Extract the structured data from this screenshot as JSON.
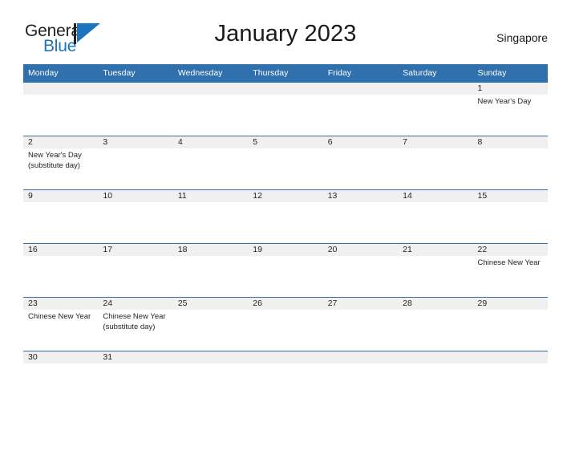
{
  "brand": {
    "name_part1": "General",
    "name_part2": "Blue",
    "mark_icon": "triangle-flag-icon"
  },
  "header": {
    "title": "January 2023",
    "locale": "Singapore"
  },
  "calendar": {
    "weekday_headers": [
      "Monday",
      "Tuesday",
      "Wednesday",
      "Thursday",
      "Friday",
      "Saturday",
      "Sunday"
    ],
    "weeks": [
      {
        "days": [
          {
            "date": "",
            "events": []
          },
          {
            "date": "",
            "events": []
          },
          {
            "date": "",
            "events": []
          },
          {
            "date": "",
            "events": []
          },
          {
            "date": "",
            "events": []
          },
          {
            "date": "",
            "events": []
          },
          {
            "date": "1",
            "events": [
              "New Year's Day"
            ]
          }
        ]
      },
      {
        "days": [
          {
            "date": "2",
            "events": [
              "New Year's Day",
              "(substitute day)"
            ]
          },
          {
            "date": "3",
            "events": []
          },
          {
            "date": "4",
            "events": []
          },
          {
            "date": "5",
            "events": []
          },
          {
            "date": "6",
            "events": []
          },
          {
            "date": "7",
            "events": []
          },
          {
            "date": "8",
            "events": []
          }
        ]
      },
      {
        "days": [
          {
            "date": "9",
            "events": []
          },
          {
            "date": "10",
            "events": []
          },
          {
            "date": "11",
            "events": []
          },
          {
            "date": "12",
            "events": []
          },
          {
            "date": "13",
            "events": []
          },
          {
            "date": "14",
            "events": []
          },
          {
            "date": "15",
            "events": []
          }
        ]
      },
      {
        "days": [
          {
            "date": "16",
            "events": []
          },
          {
            "date": "17",
            "events": []
          },
          {
            "date": "18",
            "events": []
          },
          {
            "date": "19",
            "events": []
          },
          {
            "date": "20",
            "events": []
          },
          {
            "date": "21",
            "events": []
          },
          {
            "date": "22",
            "events": [
              "Chinese New Year"
            ]
          }
        ]
      },
      {
        "days": [
          {
            "date": "23",
            "events": [
              "Chinese New Year"
            ]
          },
          {
            "date": "24",
            "events": [
              "Chinese New Year",
              "(substitute day)"
            ]
          },
          {
            "date": "25",
            "events": []
          },
          {
            "date": "26",
            "events": []
          },
          {
            "date": "27",
            "events": []
          },
          {
            "date": "28",
            "events": []
          },
          {
            "date": "29",
            "events": []
          }
        ]
      },
      {
        "days": [
          {
            "date": "30",
            "events": []
          },
          {
            "date": "31",
            "events": []
          },
          {
            "date": "",
            "events": []
          },
          {
            "date": "",
            "events": []
          },
          {
            "date": "",
            "events": []
          },
          {
            "date": "",
            "events": []
          },
          {
            "date": "",
            "events": []
          }
        ]
      }
    ]
  },
  "colors": {
    "header_blue": "#3071ad",
    "rule_blue": "#3071ad",
    "brand_blue": "#1c75bc",
    "daynum_band": "#f0f0f0",
    "text_dark": "#231f20"
  }
}
